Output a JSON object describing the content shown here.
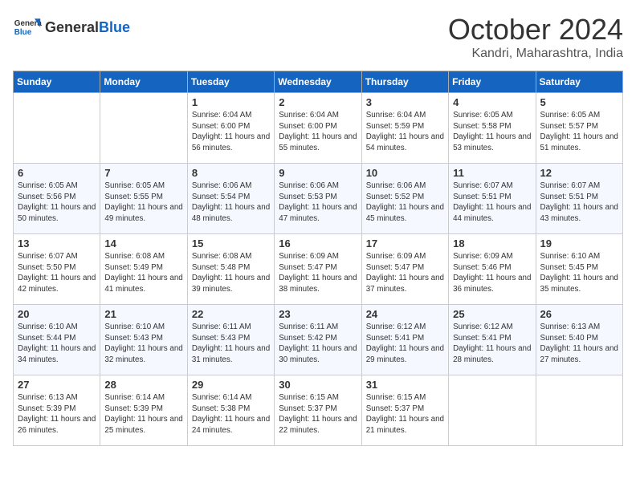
{
  "header": {
    "logo_general": "General",
    "logo_blue": "Blue",
    "month": "October 2024",
    "location": "Kandri, Maharashtra, India"
  },
  "columns": [
    "Sunday",
    "Monday",
    "Tuesday",
    "Wednesday",
    "Thursday",
    "Friday",
    "Saturday"
  ],
  "weeks": [
    [
      {
        "day": "",
        "sunrise": "",
        "sunset": "",
        "daylight": ""
      },
      {
        "day": "",
        "sunrise": "",
        "sunset": "",
        "daylight": ""
      },
      {
        "day": "1",
        "sunrise": "Sunrise: 6:04 AM",
        "sunset": "Sunset: 6:00 PM",
        "daylight": "Daylight: 11 hours and 56 minutes."
      },
      {
        "day": "2",
        "sunrise": "Sunrise: 6:04 AM",
        "sunset": "Sunset: 6:00 PM",
        "daylight": "Daylight: 11 hours and 55 minutes."
      },
      {
        "day": "3",
        "sunrise": "Sunrise: 6:04 AM",
        "sunset": "Sunset: 5:59 PM",
        "daylight": "Daylight: 11 hours and 54 minutes."
      },
      {
        "day": "4",
        "sunrise": "Sunrise: 6:05 AM",
        "sunset": "Sunset: 5:58 PM",
        "daylight": "Daylight: 11 hours and 53 minutes."
      },
      {
        "day": "5",
        "sunrise": "Sunrise: 6:05 AM",
        "sunset": "Sunset: 5:57 PM",
        "daylight": "Daylight: 11 hours and 51 minutes."
      }
    ],
    [
      {
        "day": "6",
        "sunrise": "Sunrise: 6:05 AM",
        "sunset": "Sunset: 5:56 PM",
        "daylight": "Daylight: 11 hours and 50 minutes."
      },
      {
        "day": "7",
        "sunrise": "Sunrise: 6:05 AM",
        "sunset": "Sunset: 5:55 PM",
        "daylight": "Daylight: 11 hours and 49 minutes."
      },
      {
        "day": "8",
        "sunrise": "Sunrise: 6:06 AM",
        "sunset": "Sunset: 5:54 PM",
        "daylight": "Daylight: 11 hours and 48 minutes."
      },
      {
        "day": "9",
        "sunrise": "Sunrise: 6:06 AM",
        "sunset": "Sunset: 5:53 PM",
        "daylight": "Daylight: 11 hours and 47 minutes."
      },
      {
        "day": "10",
        "sunrise": "Sunrise: 6:06 AM",
        "sunset": "Sunset: 5:52 PM",
        "daylight": "Daylight: 11 hours and 45 minutes."
      },
      {
        "day": "11",
        "sunrise": "Sunrise: 6:07 AM",
        "sunset": "Sunset: 5:51 PM",
        "daylight": "Daylight: 11 hours and 44 minutes."
      },
      {
        "day": "12",
        "sunrise": "Sunrise: 6:07 AM",
        "sunset": "Sunset: 5:51 PM",
        "daylight": "Daylight: 11 hours and 43 minutes."
      }
    ],
    [
      {
        "day": "13",
        "sunrise": "Sunrise: 6:07 AM",
        "sunset": "Sunset: 5:50 PM",
        "daylight": "Daylight: 11 hours and 42 minutes."
      },
      {
        "day": "14",
        "sunrise": "Sunrise: 6:08 AM",
        "sunset": "Sunset: 5:49 PM",
        "daylight": "Daylight: 11 hours and 41 minutes."
      },
      {
        "day": "15",
        "sunrise": "Sunrise: 6:08 AM",
        "sunset": "Sunset: 5:48 PM",
        "daylight": "Daylight: 11 hours and 39 minutes."
      },
      {
        "day": "16",
        "sunrise": "Sunrise: 6:09 AM",
        "sunset": "Sunset: 5:47 PM",
        "daylight": "Daylight: 11 hours and 38 minutes."
      },
      {
        "day": "17",
        "sunrise": "Sunrise: 6:09 AM",
        "sunset": "Sunset: 5:47 PM",
        "daylight": "Daylight: 11 hours and 37 minutes."
      },
      {
        "day": "18",
        "sunrise": "Sunrise: 6:09 AM",
        "sunset": "Sunset: 5:46 PM",
        "daylight": "Daylight: 11 hours and 36 minutes."
      },
      {
        "day": "19",
        "sunrise": "Sunrise: 6:10 AM",
        "sunset": "Sunset: 5:45 PM",
        "daylight": "Daylight: 11 hours and 35 minutes."
      }
    ],
    [
      {
        "day": "20",
        "sunrise": "Sunrise: 6:10 AM",
        "sunset": "Sunset: 5:44 PM",
        "daylight": "Daylight: 11 hours and 34 minutes."
      },
      {
        "day": "21",
        "sunrise": "Sunrise: 6:10 AM",
        "sunset": "Sunset: 5:43 PM",
        "daylight": "Daylight: 11 hours and 32 minutes."
      },
      {
        "day": "22",
        "sunrise": "Sunrise: 6:11 AM",
        "sunset": "Sunset: 5:43 PM",
        "daylight": "Daylight: 11 hours and 31 minutes."
      },
      {
        "day": "23",
        "sunrise": "Sunrise: 6:11 AM",
        "sunset": "Sunset: 5:42 PM",
        "daylight": "Daylight: 11 hours and 30 minutes."
      },
      {
        "day": "24",
        "sunrise": "Sunrise: 6:12 AM",
        "sunset": "Sunset: 5:41 PM",
        "daylight": "Daylight: 11 hours and 29 minutes."
      },
      {
        "day": "25",
        "sunrise": "Sunrise: 6:12 AM",
        "sunset": "Sunset: 5:41 PM",
        "daylight": "Daylight: 11 hours and 28 minutes."
      },
      {
        "day": "26",
        "sunrise": "Sunrise: 6:13 AM",
        "sunset": "Sunset: 5:40 PM",
        "daylight": "Daylight: 11 hours and 27 minutes."
      }
    ],
    [
      {
        "day": "27",
        "sunrise": "Sunrise: 6:13 AM",
        "sunset": "Sunset: 5:39 PM",
        "daylight": "Daylight: 11 hours and 26 minutes."
      },
      {
        "day": "28",
        "sunrise": "Sunrise: 6:14 AM",
        "sunset": "Sunset: 5:39 PM",
        "daylight": "Daylight: 11 hours and 25 minutes."
      },
      {
        "day": "29",
        "sunrise": "Sunrise: 6:14 AM",
        "sunset": "Sunset: 5:38 PM",
        "daylight": "Daylight: 11 hours and 24 minutes."
      },
      {
        "day": "30",
        "sunrise": "Sunrise: 6:15 AM",
        "sunset": "Sunset: 5:37 PM",
        "daylight": "Daylight: 11 hours and 22 minutes."
      },
      {
        "day": "31",
        "sunrise": "Sunrise: 6:15 AM",
        "sunset": "Sunset: 5:37 PM",
        "daylight": "Daylight: 11 hours and 21 minutes."
      },
      {
        "day": "",
        "sunrise": "",
        "sunset": "",
        "daylight": ""
      },
      {
        "day": "",
        "sunrise": "",
        "sunset": "",
        "daylight": ""
      }
    ]
  ]
}
